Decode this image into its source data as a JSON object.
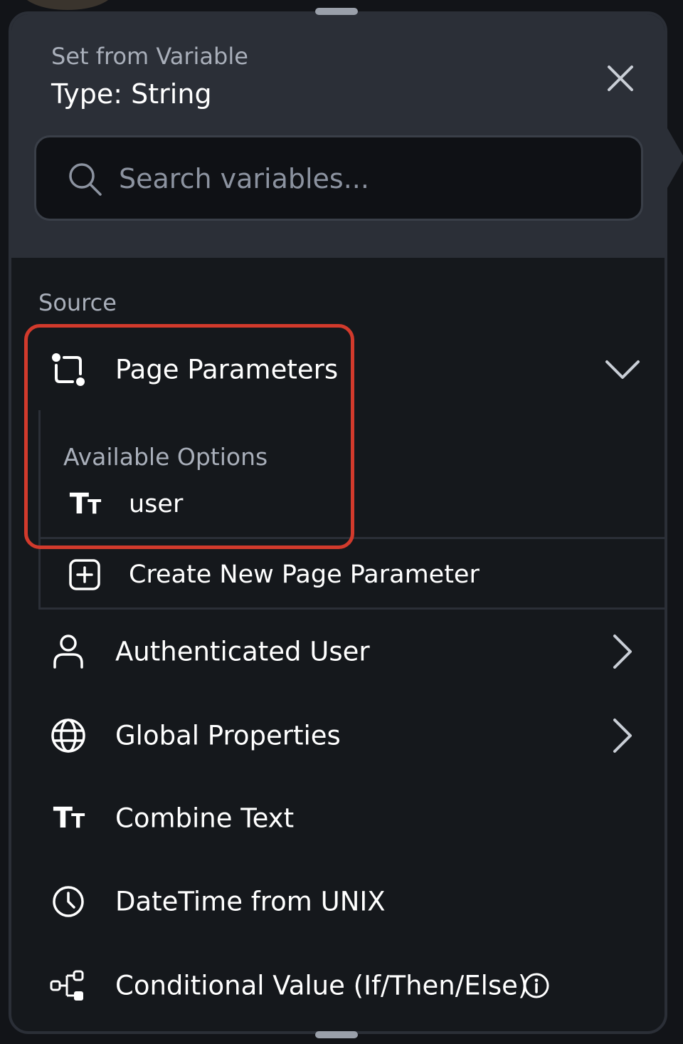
{
  "header": {
    "subtitle": "Set from Variable",
    "title": "Type: String",
    "close_icon": "close-icon"
  },
  "search": {
    "placeholder": "Search variables...",
    "value": "",
    "icon": "search-icon"
  },
  "source": {
    "label": "Source",
    "items": [
      {
        "label": "Page Parameters",
        "icon": "page-parameters-icon",
        "expanded": true
      },
      {
        "label": "Authenticated User",
        "icon": "user-icon",
        "has_submenu": true
      },
      {
        "label": "Global Properties",
        "icon": "globe-icon",
        "has_submenu": true
      },
      {
        "label": "Combine Text",
        "icon": "text-type-icon"
      },
      {
        "label": "DateTime from UNIX",
        "icon": "clock-icon"
      },
      {
        "label": "Conditional Value (If/Then/Else)",
        "icon": "conditional-icon",
        "info_icon": "info-icon"
      }
    ]
  },
  "page_parameters": {
    "options_heading": "Available Options",
    "options": [
      {
        "label": "user",
        "icon": "text-type-icon"
      }
    ],
    "create_label": "Create New Page Parameter",
    "create_icon": "add-square-icon"
  },
  "colors": {
    "panel_bg": "#15181c",
    "header_bg": "#2b2f37",
    "highlight": "#d23a2c",
    "muted_text": "#a9afba"
  }
}
